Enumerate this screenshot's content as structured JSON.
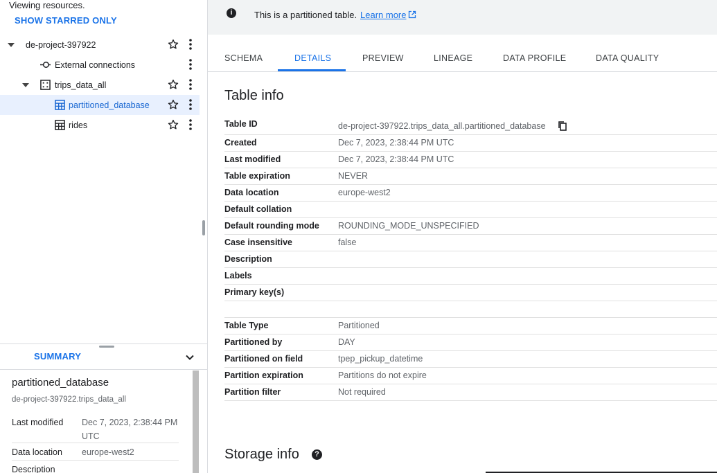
{
  "explorer": {
    "viewing_text": "Viewing resources.",
    "show_starred_label": "SHOW STARRED ONLY",
    "tree": {
      "project": "de-project-397922",
      "external_connections": "External connections",
      "dataset": "trips_data_all",
      "table_selected": "partitioned_database",
      "table_other": "rides"
    }
  },
  "summary": {
    "tab_label": "SUMMARY",
    "title": "partitioned_database",
    "subtitle": "de-project-397922.trips_data_all",
    "rows": [
      {
        "key": "Last modified",
        "value": "Dec 7, 2023, 2:38:44 PM UTC"
      },
      {
        "key": "Data location",
        "value": "europe-west2"
      },
      {
        "key": "Description",
        "value": ""
      }
    ]
  },
  "banner": {
    "text": "This is a partitioned table.",
    "link": "Learn more"
  },
  "tabs": [
    "SCHEMA",
    "DETAILS",
    "PREVIEW",
    "LINEAGE",
    "DATA PROFILE",
    "DATA QUALITY"
  ],
  "active_tab": "DETAILS",
  "table_info": {
    "title": "Table info",
    "rows": [
      {
        "key": "Table ID",
        "value": "de-project-397922.trips_data_all.partitioned_database"
      },
      {
        "key": "Created",
        "value": "Dec 7, 2023, 2:38:44 PM UTC"
      },
      {
        "key": "Last modified",
        "value": "Dec 7, 2023, 2:38:44 PM UTC"
      },
      {
        "key": "Table expiration",
        "value": "NEVER"
      },
      {
        "key": "Data location",
        "value": "europe-west2"
      },
      {
        "key": "Default collation",
        "value": ""
      },
      {
        "key": "Default rounding mode",
        "value": "ROUNDING_MODE_UNSPECIFIED"
      },
      {
        "key": "Case insensitive",
        "value": "false"
      },
      {
        "key": "Description",
        "value": ""
      },
      {
        "key": "Labels",
        "value": ""
      },
      {
        "key": "Primary key(s)",
        "value": ""
      }
    ],
    "partition_rows": [
      {
        "key": "Table Type",
        "value": "Partitioned"
      },
      {
        "key": "Partitioned by",
        "value": "DAY"
      },
      {
        "key": "Partitioned on field",
        "value": "tpep_pickup_datetime"
      },
      {
        "key": "Partition expiration",
        "value": "Partitions do not expire"
      },
      {
        "key": "Partition filter",
        "value": "Not required"
      }
    ]
  },
  "storage_info": {
    "title": "Storage info"
  },
  "colors": {
    "accent": "#1a73e8",
    "selected_bg": "#e8f0fe"
  }
}
